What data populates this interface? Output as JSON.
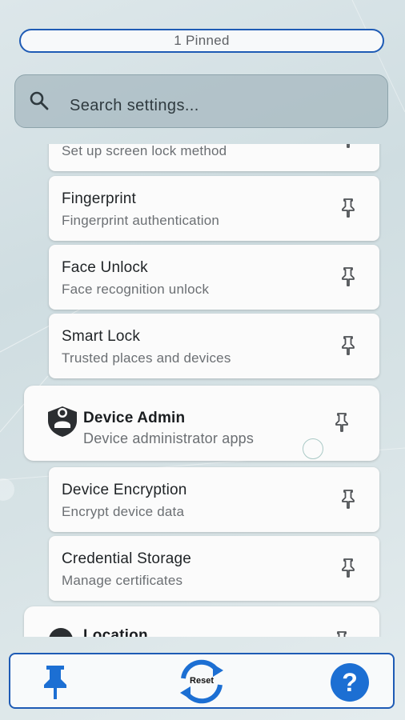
{
  "pinned_bar": {
    "label": "1 Pinned"
  },
  "search": {
    "placeholder": "Search settings..."
  },
  "items": [
    {
      "title": "",
      "description": "Set up screen lock method"
    },
    {
      "title": "Fingerprint",
      "description": "Fingerprint authentication"
    },
    {
      "title": "Face Unlock",
      "description": "Face recognition unlock"
    },
    {
      "title": "Smart Lock",
      "description": "Trusted places and devices"
    },
    {
      "title": "Device Admin",
      "description": "Device administrator apps"
    },
    {
      "title": "Device Encryption",
      "description": "Encrypt device data"
    },
    {
      "title": "Credential Storage",
      "description": "Manage certificates"
    },
    {
      "title": "Location",
      "description": ""
    }
  ],
  "bottom_nav": {
    "pin_icon": "pin-icon",
    "reset_label": "Reset",
    "help_icon": "help-icon"
  },
  "colors": {
    "accent": "#1e5bb5",
    "help": "#1c6fd3"
  }
}
